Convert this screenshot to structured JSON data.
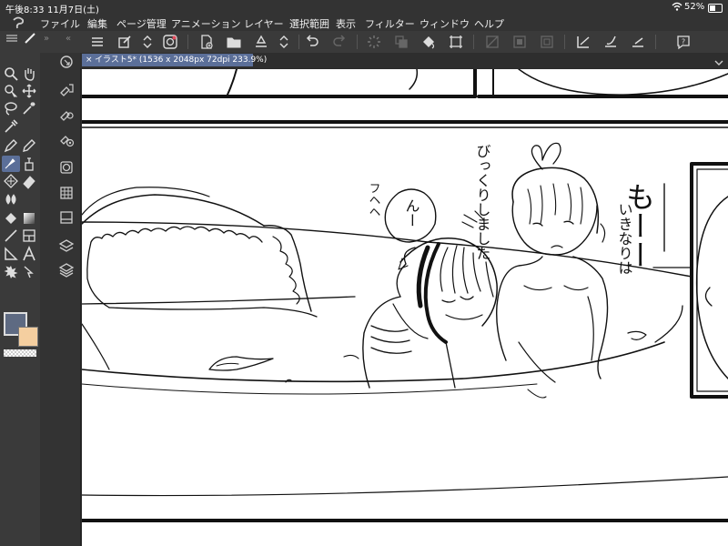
{
  "status": {
    "time": "午後8:33",
    "date": "11月7日(土)",
    "battery": "52%"
  },
  "menu": {
    "items": [
      "ファイル",
      "編集",
      "ページ管理",
      "アニメーション",
      "レイヤー",
      "選択範囲",
      "表示",
      "フィルター",
      "ウィンドウ",
      "ヘルプ"
    ]
  },
  "document": {
    "tab_label": "イラスト5* (1536 x 2048px 72dpi 233.9%)",
    "close": "×"
  },
  "canvas_text": {
    "moo": "もーー",
    "suddenly": "いきなりは",
    "surprised": "びっくりしました",
    "hehe": "フヘヘ",
    "nn": "んー"
  },
  "colors": {
    "main": "#5e6a82",
    "sub": "#f5cfa0",
    "accent": "#5b6f99"
  }
}
